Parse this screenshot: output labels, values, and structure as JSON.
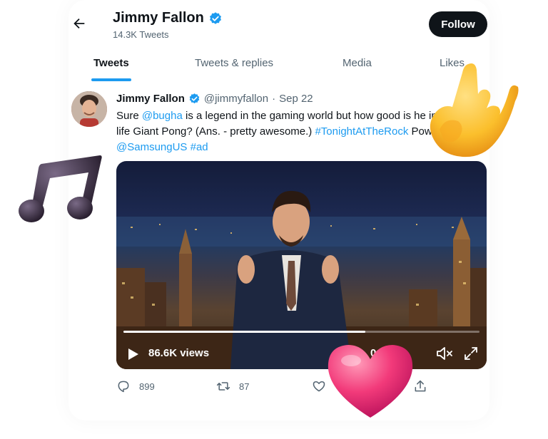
{
  "header": {
    "name": "Jimmy Fallon",
    "tweet_count": "14.3K Tweets",
    "follow_label": "Follow"
  },
  "tabs": [
    {
      "label": "Tweets",
      "active": true
    },
    {
      "label": "Tweets & replies",
      "active": false
    },
    {
      "label": "Media",
      "active": false
    },
    {
      "label": "Likes",
      "active": false
    }
  ],
  "tweet": {
    "name": "Jimmy Fallon",
    "handle": "@jimmyfallon",
    "separator": "·",
    "date": "Sep 22",
    "text_1": "Sure ",
    "mention_1": "@bugha",
    "text_2": " is a legend in the gaming world but how good is he in real life Giant Pong? (Ans. - pretty awesome.) ",
    "hashtag_1": "#TonightAtTheRock",
    "text_3": " Powered by ",
    "mention_2": "@SamsungUS",
    "text_4": " ",
    "hashtag_2": "#ad",
    "video": {
      "views": "86.6K views",
      "duration": "0:28",
      "progress": 0.68
    },
    "actions": {
      "replies": "899",
      "retweets": "87"
    }
  },
  "colors": {
    "accent": "#1d9bf0",
    "text": "#0f1419",
    "muted": "#536471"
  },
  "stickers": [
    "music-note-sticker",
    "ok-hand-sticker",
    "heart-sticker"
  ]
}
